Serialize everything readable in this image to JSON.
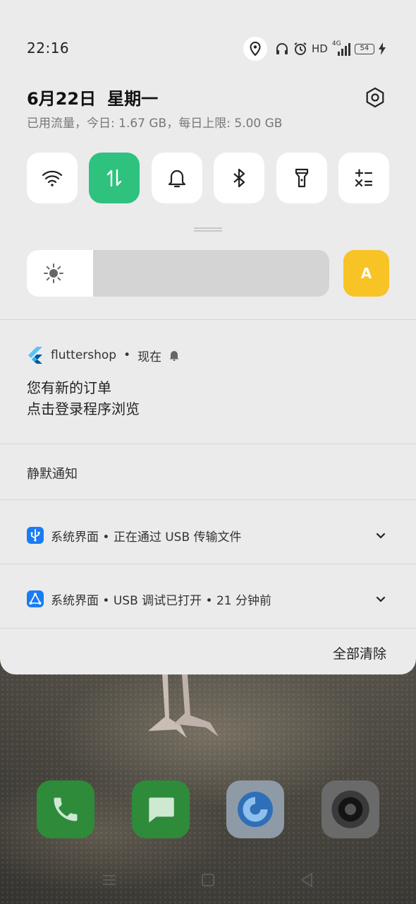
{
  "status_bar": {
    "time": "22:16",
    "hd_label": "HD",
    "network_label": "4G",
    "battery_level": "54",
    "icons": [
      "location-icon",
      "headphones-icon",
      "alarm-icon",
      "signal-icon",
      "battery-icon",
      "charging-icon"
    ]
  },
  "header": {
    "date": "6月22日",
    "weekday": "星期一",
    "data_usage": "已用流量，今日: 1.67 GB，每日上限: 5.00 GB",
    "settings_icon": "gear-icon"
  },
  "quick_settings": {
    "tiles": [
      {
        "name": "wifi",
        "icon": "wifi-icon",
        "active": false
      },
      {
        "name": "mobile-data",
        "icon": "mobile-data-icon",
        "active": true
      },
      {
        "name": "sound",
        "icon": "bell-icon",
        "active": false
      },
      {
        "name": "bluetooth",
        "icon": "bluetooth-icon",
        "active": false
      },
      {
        "name": "flashlight",
        "icon": "flashlight-icon",
        "active": false
      },
      {
        "name": "calculator",
        "icon": "calculator-icon",
        "active": false
      }
    ],
    "active_color": "#2ec27e"
  },
  "brightness": {
    "level": 0.22,
    "auto_label": "A",
    "auto_color": "#f7c325"
  },
  "notifications": [
    {
      "app": "fluttershop",
      "time": "现在",
      "title": "您有新的订单",
      "body": "点击登录程序浏览"
    }
  ],
  "silent_section_label": "静默通知",
  "silent_notifications": [
    {
      "text": "系统界面 • 正在通过 USB 传输文件",
      "icon": "usb-icon"
    },
    {
      "text": "系统界面 • USB 调试已打开 • 21 分钟前",
      "icon": "debug-icon"
    }
  ],
  "clear_all_label": "全部清除",
  "dock": [
    {
      "name": "phone",
      "icon": "phone-icon",
      "color": "#2e8b3a"
    },
    {
      "name": "messages",
      "icon": "message-icon",
      "color": "#2e8b3a"
    },
    {
      "name": "browser",
      "icon": "browser-icon",
      "color": "#5a6c80"
    },
    {
      "name": "camera",
      "icon": "camera-icon",
      "color": "#5c5c5c"
    }
  ]
}
